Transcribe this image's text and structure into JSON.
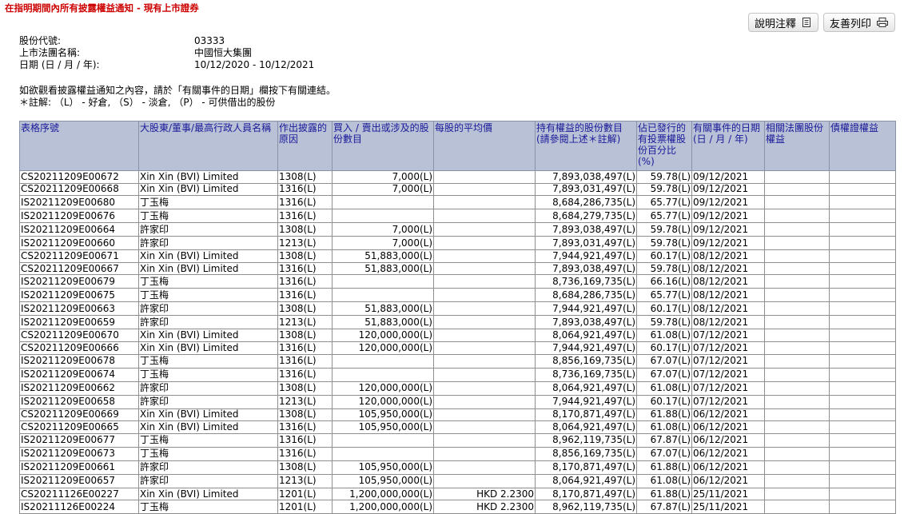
{
  "page_title": "在指明期間內所有披露權益通知 - 現有上市證券",
  "buttons": {
    "help": "說明注釋",
    "print": "友善列印"
  },
  "info": {
    "stock_code_label": "股份代號:",
    "stock_code": "03333",
    "company_label": "上市法團名稱:",
    "company": "中國恒大集團",
    "date_label": "日期 (日 / 月 / 年):",
    "date_range": "10/12/2020 - 10/12/2021"
  },
  "notes": {
    "line1": "如欲觀看披露權益通知之內容，請於「有關事件的日期」欄按下有關連結。",
    "line2": "＊註解: （L） - 好倉, （S） - 淡倉, （P） - 可供借出的股份"
  },
  "table": {
    "headers": [
      "表格序號",
      "大股東/董事/最高行政人員名稱",
      "作出披露的原因",
      "買入 / 賣出或涉及的股份數目",
      "每股的平均價",
      "持有權益的股份數目 (請參閱上述＊註解)",
      "佔已發行的有投票權股份百分比 (%)",
      "有關事件的日期 (日 / 月 / 年)",
      "相關法團股份權益",
      "債權證權益"
    ],
    "rows": [
      [
        "CS20211209E00672",
        "Xin Xin (BVI) Limited",
        "1308(L)",
        "7,000(L)",
        "",
        "7,893,038,497(L)",
        "59.78(L)",
        "09/12/2021",
        "",
        ""
      ],
      [
        "CS20211209E00668",
        "Xin Xin (BVI) Limited",
        "1316(L)",
        "7,000(L)",
        "",
        "7,893,031,497(L)",
        "59.78(L)",
        "09/12/2021",
        "",
        ""
      ],
      [
        "IS20211209E00680",
        "丁玉梅",
        "1316(L)",
        "",
        "",
        "8,684,286,735(L)",
        "65.77(L)",
        "09/12/2021",
        "",
        ""
      ],
      [
        "IS20211209E00676",
        "丁玉梅",
        "1316(L)",
        "",
        "",
        "8,684,279,735(L)",
        "65.77(L)",
        "09/12/2021",
        "",
        ""
      ],
      [
        "IS20211209E00664",
        "許家印",
        "1308(L)",
        "7,000(L)",
        "",
        "7,893,038,497(L)",
        "59.78(L)",
        "09/12/2021",
        "",
        ""
      ],
      [
        "IS20211209E00660",
        "許家印",
        "1213(L)",
        "7,000(L)",
        "",
        "7,893,031,497(L)",
        "59.78(L)",
        "09/12/2021",
        "",
        ""
      ],
      [
        "CS20211209E00671",
        "Xin Xin (BVI) Limited",
        "1308(L)",
        "51,883,000(L)",
        "",
        "7,944,921,497(L)",
        "60.17(L)",
        "08/12/2021",
        "",
        ""
      ],
      [
        "CS20211209E00667",
        "Xin Xin (BVI) Limited",
        "1316(L)",
        "51,883,000(L)",
        "",
        "7,893,038,497(L)",
        "59.78(L)",
        "08/12/2021",
        "",
        ""
      ],
      [
        "IS20211209E00679",
        "丁玉梅",
        "1316(L)",
        "",
        "",
        "8,736,169,735(L)",
        "66.16(L)",
        "08/12/2021",
        "",
        ""
      ],
      [
        "IS20211209E00675",
        "丁玉梅",
        "1316(L)",
        "",
        "",
        "8,684,286,735(L)",
        "65.77(L)",
        "08/12/2021",
        "",
        ""
      ],
      [
        "IS20211209E00663",
        "許家印",
        "1308(L)",
        "51,883,000(L)",
        "",
        "7,944,921,497(L)",
        "60.17(L)",
        "08/12/2021",
        "",
        ""
      ],
      [
        "IS20211209E00659",
        "許家印",
        "1213(L)",
        "51,883,000(L)",
        "",
        "7,893,038,497(L)",
        "59.78(L)",
        "08/12/2021",
        "",
        ""
      ],
      [
        "CS20211209E00670",
        "Xin Xin (BVI) Limited",
        "1308(L)",
        "120,000,000(L)",
        "",
        "8,064,921,497(L)",
        "61.08(L)",
        "07/12/2021",
        "",
        ""
      ],
      [
        "CS20211209E00666",
        "Xin Xin (BVI) Limited",
        "1316(L)",
        "120,000,000(L)",
        "",
        "7,944,921,497(L)",
        "60.17(L)",
        "07/12/2021",
        "",
        ""
      ],
      [
        "IS20211209E00678",
        "丁玉梅",
        "1316(L)",
        "",
        "",
        "8,856,169,735(L)",
        "67.07(L)",
        "07/12/2021",
        "",
        ""
      ],
      [
        "IS20211209E00674",
        "丁玉梅",
        "1316(L)",
        "",
        "",
        "8,736,169,735(L)",
        "67.07(L)",
        "07/12/2021",
        "",
        ""
      ],
      [
        "IS20211209E00662",
        "許家印",
        "1308(L)",
        "120,000,000(L)",
        "",
        "8,064,921,497(L)",
        "61.08(L)",
        "07/12/2021",
        "",
        ""
      ],
      [
        "IS20211209E00658",
        "許家印",
        "1213(L)",
        "120,000,000(L)",
        "",
        "7,944,921,497(L)",
        "60.17(L)",
        "07/12/2021",
        "",
        ""
      ],
      [
        "CS20211209E00669",
        "Xin Xin (BVI) Limited",
        "1308(L)",
        "105,950,000(L)",
        "",
        "8,170,871,497(L)",
        "61.88(L)",
        "06/12/2021",
        "",
        ""
      ],
      [
        "CS20211209E00665",
        "Xin Xin (BVI) Limited",
        "1316(L)",
        "105,950,000(L)",
        "",
        "8,064,921,497(L)",
        "61.08(L)",
        "06/12/2021",
        "",
        ""
      ],
      [
        "IS20211209E00677",
        "丁玉梅",
        "1316(L)",
        "",
        "",
        "8,962,119,735(L)",
        "67.87(L)",
        "06/12/2021",
        "",
        ""
      ],
      [
        "IS20211209E00673",
        "丁玉梅",
        "1316(L)",
        "",
        "",
        "8,856,169,735(L)",
        "67.07(L)",
        "06/12/2021",
        "",
        ""
      ],
      [
        "IS20211209E00661",
        "許家印",
        "1308(L)",
        "105,950,000(L)",
        "",
        "8,170,871,497(L)",
        "61.88(L)",
        "06/12/2021",
        "",
        ""
      ],
      [
        "IS20211209E00657",
        "許家印",
        "1213(L)",
        "105,950,000(L)",
        "",
        "8,064,921,497(L)",
        "61.08(L)",
        "06/12/2021",
        "",
        ""
      ],
      [
        "CS20211126E00227",
        "Xin Xin (BVI) Limited",
        "1201(L)",
        "1,200,000,000(L)",
        "HKD 2.2300",
        "8,170,871,497(L)",
        "61.88(L)",
        "25/11/2021",
        "",
        ""
      ],
      [
        "IS20211126E00224",
        "丁玉梅",
        "1201(L)",
        "1,200,000,000(L)",
        "HKD 2.2300",
        "8,962,119,735(L)",
        "67.87(L)",
        "25/11/2021",
        "",
        ""
      ]
    ]
  }
}
